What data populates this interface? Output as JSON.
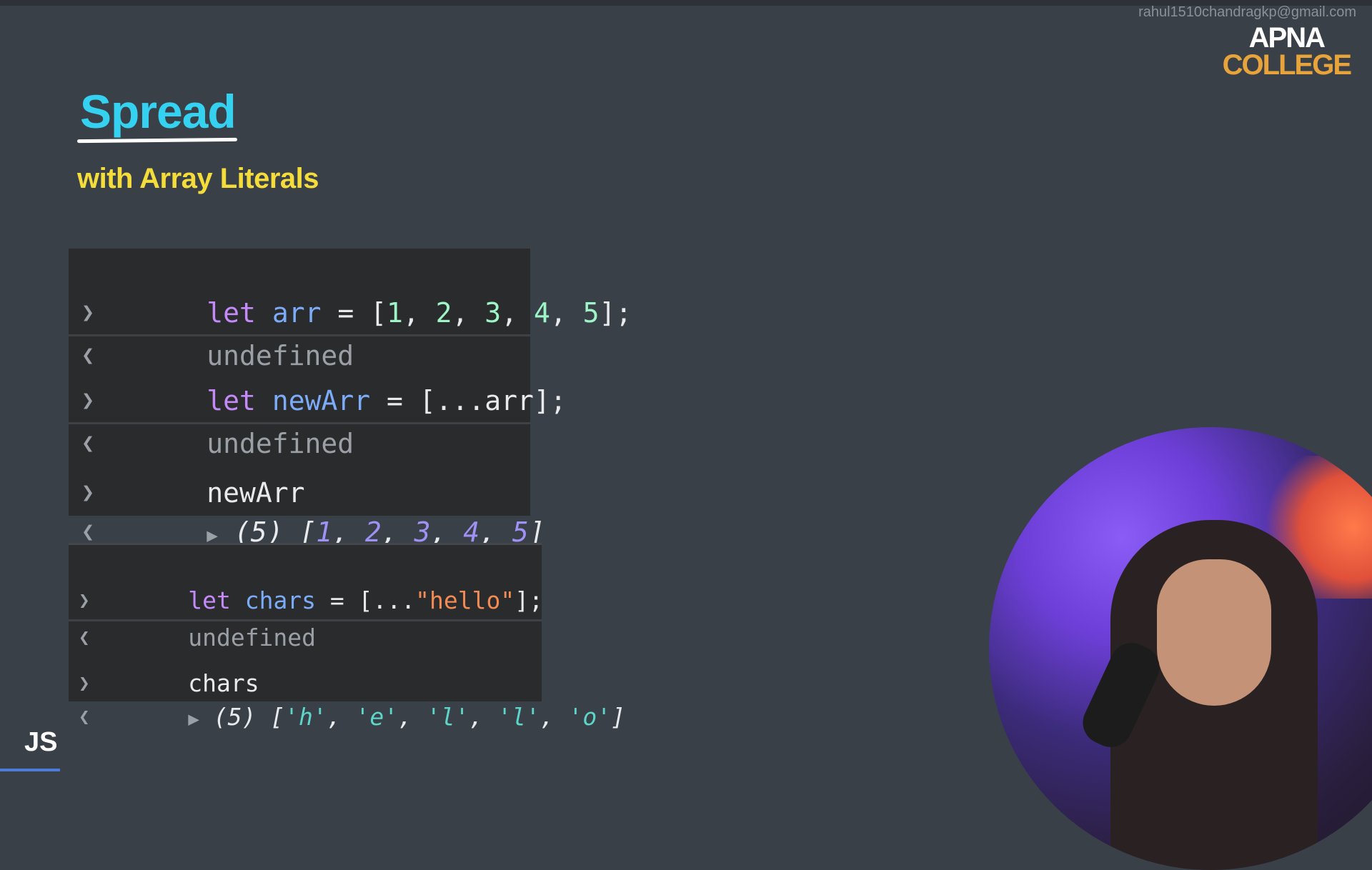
{
  "watermark_email": "rahul1510chandragkp@gmail.com",
  "logo": {
    "line1": "APNA",
    "line2": "COLLEGE"
  },
  "heading": {
    "title": "Spread",
    "subtitle": "with Array Literals"
  },
  "console1": {
    "entries": [
      {
        "input": {
          "kw": "let",
          "var": "arr",
          "eq": " = ",
          "open": "[",
          "n1": "1",
          "n2": "2",
          "n3": "3",
          "n4": "4",
          "n5": "5",
          "close": "];",
          "comma": ", "
        },
        "output": "undefined"
      },
      {
        "input": {
          "kw": "let",
          "var": "newArr",
          "eq": " = ",
          "rest": "[...arr];"
        },
        "output": "undefined"
      },
      {
        "input": {
          "text": "newArr"
        },
        "output": {
          "count": "(5)",
          "open": "[",
          "n1": "1",
          "n2": "2",
          "n3": "3",
          "n4": "4",
          "n5": "5",
          "close": "]",
          "comma": ", "
        }
      }
    ]
  },
  "console2": {
    "entries": [
      {
        "input": {
          "kw": "let",
          "var": "chars",
          "eq": " = ",
          "spread": "[...",
          "str": "\"hello\"",
          "close": "];"
        },
        "output": "undefined"
      },
      {
        "input": {
          "text": "chars"
        },
        "output": {
          "count": "(5)",
          "open": "[",
          "c1": "'h'",
          "c2": "'e'",
          "c3": "'l'",
          "c4": "'l'",
          "c5": "'o'",
          "close": "]",
          "comma": ", "
        }
      }
    ]
  },
  "badge": "JS",
  "icons": {
    "prompt": "chevron-right-icon",
    "result": "chevron-left-icon",
    "expand": "triangle-right-icon"
  },
  "colors": {
    "title": "#34d2f0",
    "subtitle": "#f4dc3a",
    "background": "#3a4048",
    "console_bg": "#2a2b2d"
  }
}
